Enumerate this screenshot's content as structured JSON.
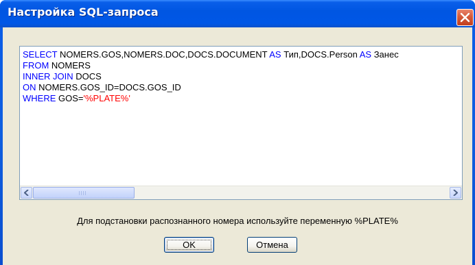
{
  "window": {
    "title": "Настройка SQL-запроса"
  },
  "editor": {
    "lines": [
      [
        {
          "text": "SELECT",
          "kind": "keyword"
        },
        {
          "text": " NOMERS.GOS,NOMERS.DOC,DOCS.DOCUMENT ",
          "kind": "plain"
        },
        {
          "text": "AS",
          "kind": "keyword"
        },
        {
          "text": " Тип,DOCS.Person ",
          "kind": "plain"
        },
        {
          "text": "AS",
          "kind": "keyword"
        },
        {
          "text": " Занес",
          "kind": "plain"
        }
      ],
      [
        {
          "text": "FROM",
          "kind": "keyword"
        },
        {
          "text": " NOMERS",
          "kind": "plain"
        }
      ],
      [
        {
          "text": "INNER JOIN",
          "kind": "keyword"
        },
        {
          "text": " DOCS",
          "kind": "plain"
        }
      ],
      [
        {
          "text": "ON",
          "kind": "keyword"
        },
        {
          "text": " NOMERS.GOS_ID=DOCS.GOS_ID",
          "kind": "plain"
        }
      ],
      [
        {
          "text": "WHERE",
          "kind": "keyword"
        },
        {
          "text": " GOS=",
          "kind": "plain"
        },
        {
          "text": "'%PLATE%'",
          "kind": "string"
        }
      ]
    ]
  },
  "hint": "Для подстановки распознанного номера используйте переменную %PLATE%",
  "buttons": {
    "ok": "OK",
    "cancel": "Отмена"
  },
  "colors": {
    "keyword": "#0000ff",
    "string": "#ff0000",
    "plain": "#000000"
  }
}
